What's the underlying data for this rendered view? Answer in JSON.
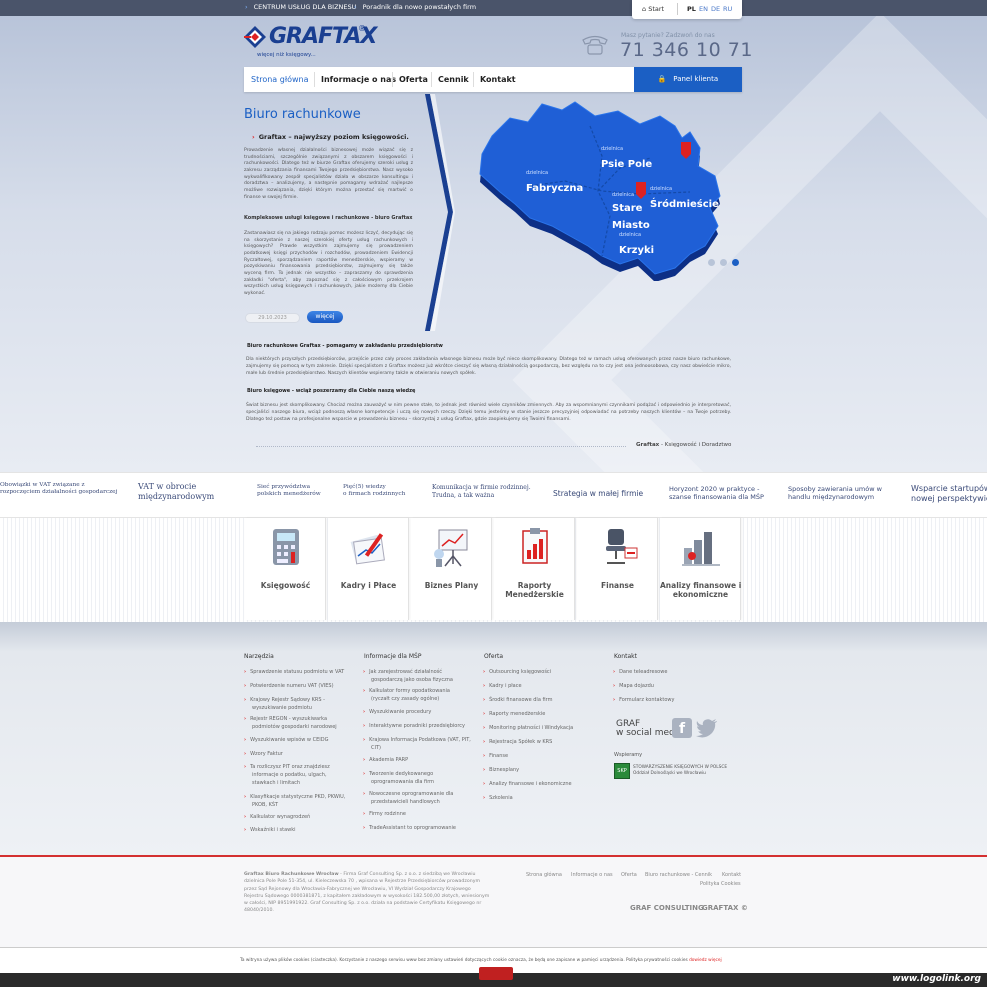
{
  "topbar": {
    "links": [
      "CENTRUM USŁUG DLA BIZNESU",
      "Poradnik dla nowo powstałych firm"
    ]
  },
  "lang": {
    "start": "Start",
    "items": [
      "PL",
      "EN",
      "DE",
      "RU"
    ]
  },
  "brand": {
    "name": "GRAFTAX",
    "tagline": "więcej niż księgowy..."
  },
  "contact": {
    "question": "Masz pytanie? Zadzwoń do nas",
    "phone": "71 346 10 71"
  },
  "nav": {
    "items": [
      "Strona główna",
      "Informacje o nas",
      "Oferta",
      "Cennik",
      "Kontakt"
    ],
    "panel": "Panel klienta"
  },
  "intro": {
    "title": "Biuro rachunkowe",
    "subtitle": "Graftax – najwyższy poziom księgowości.",
    "p1": "Prowadzenie własnej działalności biznesowej może wiązać się z trudnościami, szczególnie związanymi z obszarem księgowości i rachunkowości. Dlatego też w biurze Graftax oferujemy szeroki usług z zakresu zarządzania finansami Twojego przedsiębiorstwa. Nasz wysoko wykwalifikowany zespół specjalistów działa w obszarze konsultingu i doradztwa – analizujemy, a następnie pomagamy wdrażać najlepsze możliwe rozwiązania, dzięki którym można przestać się martwić o finanse w swojej firmie.",
    "sub2": "Kompleksowe usługi księgowe i rachunkowe - biuro Graftax",
    "p2": "Zastanawiasz się na jakiego rodzaju pomoc możesz liczyć, decydując się na skorzystanie z naszej szerokiej oferty usług rachunkowych i księgowych? Prawde wszystkim zajmujemy się prowadzeniem podatkowej księgi przychodów i rozchodów, prowadzeniem Ewidencji Ryczałtowej, sporządzaniem raportów menedżerskie, wspieramy w pozyskiwaniu finansowania przedsiębiorstw, zajmujemy się także wyceną firm. To jednak nie wszystko – zapraszamy do sprawdzenia zakładki \"oferta\", aby zapoznać się z całościowym przekrojem wszystkich usług księgowych i rachunkowych, jakie możemy dla Ciebie wykonać.",
    "date": "29.10.2023",
    "more": "więcej"
  },
  "map": {
    "districts": [
      {
        "pre": "dzielnica",
        "name": "Psie Pole"
      },
      {
        "pre": "dzielnica",
        "name": "Fabryczna"
      },
      {
        "pre": "dzielnica",
        "name": "Śródmieście"
      },
      {
        "pre": "dzielnica",
        "name": "Stare Miasto"
      },
      {
        "pre": "dzielnica",
        "name": "Krzyki"
      }
    ],
    "slider_active": 3
  },
  "body": {
    "h1": "Biuro rachunkowe Graftax - pomagamy w zakładaniu przedsiębiorstw",
    "p1": "Dla niektórych przyszłych przedsiębiorców, przejście przez cały proces zakładania własnego biznesu może być nieco skomplikowany. Dlatego też w ramach usług oferowanych przez nasze biuro rachunkowe, zajmujemy się pomocą w tym zakresie. Dzięki specjalistom z Graftax możesz już wkrótce cieszyć się własną działalnością gospodarczą, bez względu na to czy jest ona jednoosobowa, czy nasz obwieście mikro, małe lub średnie przedsiębiorstwo. Naszych klientów wspieramy także w otwieraniu nowych spółek.",
    "h2": "Biuro księgowe - wciąż poszerzamy dla Ciebie naszą wiedzę",
    "p2": "Świat biznesu jest skomplikowany. Chociaż można zauważyć w nim pewne stałe, to jednak jest również wiele czynników zmiennych. Aby za wspomnianymi czynnikami podążać i odpowiednio je interpretować, specjaliści naszego biura, wciąż podnoszą własne kompetencje i uczą się nowych rzeczy. Dzięki temu jesteśmy w stanie jeszcze precyzyjniej odpowiadać na potrzeby naszych klientów – na Twoje potrzeby. Dlatego też postaw na profesjonalne wsparcie w prowadzeniu biznesu – skorzystaj z usług Graftax, gdzie zaopiekujemy się Twoimi finansami.",
    "signature_bold": "Graftax",
    "signature_rest": " - Księgowość i Doradztwo"
  },
  "ticker": [
    "Obowiązki w VAT związane z\nrozpoczęciem działalności gospodarczej",
    "VAT w obrocie\nmiędzynarodowym",
    "Sieć przywództwa\npolskich menedżerów",
    "Pięć(5) wiedzy\no firmach rodzinnych",
    "Komunikacja w firmie rodzinnej.\nTrudna, a tak ważna",
    "Strategia w małej firmie",
    "Horyzont 2020 w praktyce -\nszanse finansowania dla MŚP",
    "Sposoby zawierania umów w\nhandlu międzynarodowym",
    "Wsparcie startupów\nnowej perspektywie"
  ],
  "services": [
    "Księgowość",
    "Kadry i Płace",
    "Biznes Plany",
    "Raporty\nMenedżerskie",
    "Finanse",
    "Analizy finansowe i\nekonomiczne"
  ],
  "footer": {
    "col1": {
      "title": "Narzędzia",
      "items": [
        "Sprawdzenie statusu podmiotu w VAT",
        "Potwierdzenie numeru VAT (VIES)",
        "Krajowy Rejestr Sądowy KRS - wyszukiwanie podmiotu",
        "Rejestr REGON - wyszukiwarka podmiotów gospodarki narodowej",
        "Wyszukiwanie wpisów w CEIDG",
        "Wzory Faktur",
        "Ta rozliczysz PIT oraz znajdziesz informacje o podatku, ulgach, stawkach i limitach",
        "Klasyfikacje statystyczne PKD, PKWiU, PKOB, KŚT",
        "Kalkulator wynagrodzeń",
        "Wskaźniki i stawki"
      ]
    },
    "col2": {
      "title": "Informacje dla MŚP",
      "items": [
        "Jak zarejestrować działalność gospodarczą jako osoba fizyczna",
        "Kalkulator formy opodatkowania (ryczałt czy zasady ogólne)",
        "Wyszukiwanie procedury",
        "Interaktywne poradniki przedsiębiorcy",
        "Krajowa Informacja Podatkowa (VAT, PIT, CIT)",
        "Akademia PARP",
        "Tworzenie dedykowanego oprogramowania dla firm",
        "Nowoczesne oprogramowanie dla przedstawicieli handlowych",
        "Firmy rodzinne",
        "TradeAssistant to oprogramowanie"
      ]
    },
    "col3": {
      "title": "Oferta",
      "items": [
        "Outsourcing księgowości",
        "Kadry i płace",
        "Środki finansowe dla firm",
        "Raporty menedżerskie",
        "Monitoring płatności i Windykacja",
        "Rejestracja Spółek w KRS",
        "Finanse",
        "Biznesplany",
        "Analizy finansowe i ekonomiczne",
        "Szkolenia"
      ]
    },
    "col4": {
      "title": "Kontakt",
      "items": [
        "Dane teleadresowe",
        "Mapa dojazdu",
        "Formularz kontaktowy"
      ],
      "social_label": "GRAF\nw social media",
      "support_label": "Wspieramy",
      "support_text": "STOWARZYSZENIE KSIĘGOWYCH W POLSCE\nOddział Dolnośląski we Wrocławiu"
    }
  },
  "legal": {
    "bold": "Graftax Biuro Rachunkowe Wrocław",
    "text": " - Firma Graf Consulting Sp. z o.o. z siedzibą we Wrocławiu dzielnica Pole Pole 51-354, ul. Kieleczewska 70 , wpisana w Rejestrze Przedsiębiorców prowadzonym przez Sąd Rejonowy dla Wrocławia-Fabrycznej we Wrocławiu, VI Wydział Gospodarczy Krajowego Rejestru Sądowego 0000381871, z kapitałem zakładowym w wysokości 182.500,00 złotych, wniesionym w całości, NIP 8951991922. Graf Consulting Sp. z o.o. działa na podstawie Certyfikatu Księgowego nr 48040/2010."
  },
  "bottom_links": [
    "Strona główna",
    "Informacje o nas",
    "Oferta",
    "Biuro rachunkowe - Cennik",
    "Kontakt",
    "Polityka Cookies"
  ],
  "bottom_brands": [
    "GRAF CONSULTING",
    "GRAFTAX ©"
  ],
  "cookie": {
    "text": "Ta witryna używa plików cookies (ciasteczka). Korzystanie z naszego serwisu www bez zmiany ustawień dotyczących cookie oznacza, że będą one zapisane w pamięci urządzenia. Polityka prywatności cookies ",
    "link": "dowiedz więcej"
  },
  "watermark": "www.logolink.org",
  "colors": {
    "brand": "#1b5fc4",
    "accent": "#d22222",
    "nav_text": "#222222"
  }
}
